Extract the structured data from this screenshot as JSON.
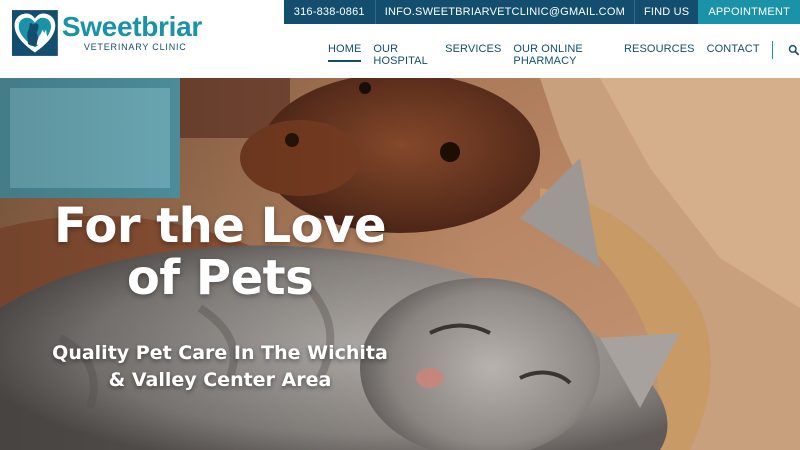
{
  "topbar": {
    "phone": "316-838-0861",
    "email": "INFO.SWEETBRIARVETCLINIC@GMAIL.COM",
    "find_us": "FIND US",
    "appointment": "APPOINTMENT"
  },
  "brand": {
    "name": "Sweetbriar",
    "subtitle": "VETERINARY CLINIC",
    "logo_icon": "heart-dog-cat-icon"
  },
  "nav": {
    "items": [
      {
        "label": "HOME",
        "active": true
      },
      {
        "label": "OUR HOSPITAL",
        "active": false
      },
      {
        "label": "SERVICES",
        "active": false
      },
      {
        "label": "OUR ONLINE PHARMACY",
        "active": false
      },
      {
        "label": "RESOURCES",
        "active": false
      },
      {
        "label": "CONTACT",
        "active": false
      }
    ],
    "search_icon": "search-icon"
  },
  "hero": {
    "title_line1": "For the Love",
    "title_line2": "of Pets",
    "subtitle_line1": "Quality Pet Care In The Wichita",
    "subtitle_line2": "& Valley Center Area",
    "image": "dog-and-cat-photo"
  },
  "colors": {
    "navy": "#134e6f",
    "teal": "#1a93a8",
    "white": "#ffffff"
  }
}
